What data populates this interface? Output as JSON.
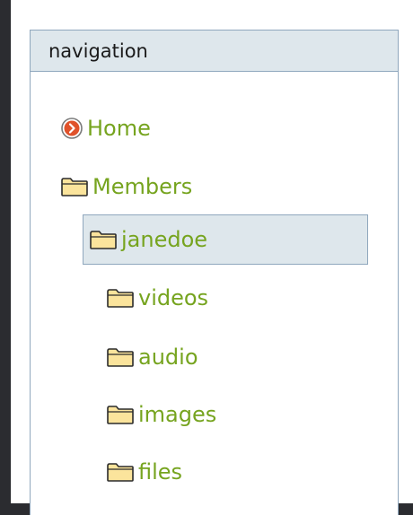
{
  "portlet": {
    "title": "navigation"
  },
  "nav": {
    "items": [
      {
        "label": "Home",
        "icon": "home-arrow-icon"
      },
      {
        "label": "Members",
        "icon": "folder-icon"
      },
      {
        "label": "janedoe",
        "icon": "folder-icon",
        "selected": true
      },
      {
        "label": "videos",
        "icon": "folder-icon"
      },
      {
        "label": "audio",
        "icon": "folder-icon"
      },
      {
        "label": "images",
        "icon": "folder-icon"
      },
      {
        "label": "files",
        "icon": "folder-icon"
      }
    ]
  },
  "colors": {
    "link": "#76a41f",
    "header_bg": "#dee7ec",
    "border": "#8fa7bd",
    "home_icon": "#e0522b"
  }
}
